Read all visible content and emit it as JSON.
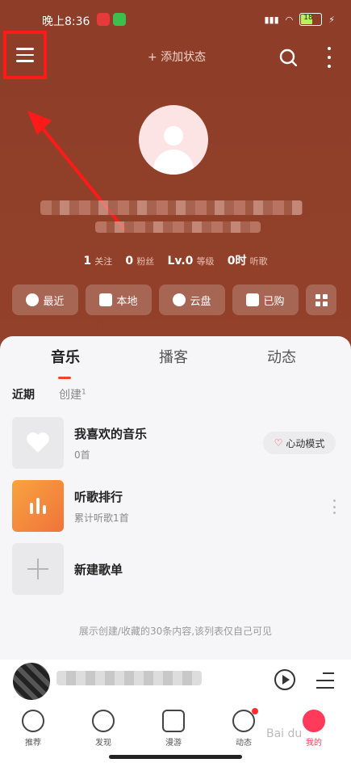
{
  "status_bar": {
    "time": "晚上8:36",
    "battery": "18"
  },
  "header": {
    "add_status": "+ 添加状态"
  },
  "profile": {
    "stats": [
      {
        "value": "1",
        "label": "关注"
      },
      {
        "value": "0",
        "label": "粉丝"
      },
      {
        "value": "Lv.0",
        "label": "等级"
      },
      {
        "value": "0时",
        "label": "听歌"
      }
    ]
  },
  "quick_actions": [
    {
      "label": "最近",
      "icon": "clock-icon"
    },
    {
      "label": "本地",
      "icon": "download-icon"
    },
    {
      "label": "云盘",
      "icon": "cloud-icon"
    },
    {
      "label": "已购",
      "icon": "bag-icon"
    },
    {
      "label": "",
      "icon": "grid-icon"
    }
  ],
  "tabs": [
    "音乐",
    "播客",
    "动态"
  ],
  "subtabs": {
    "recent": "近期",
    "created": "创建",
    "created_count": "1"
  },
  "playlists": [
    {
      "title": "我喜欢的音乐",
      "sub": "0首",
      "action": "心动模式"
    },
    {
      "title": "听歌排行",
      "sub": "累计听歌1首"
    },
    {
      "title": "新建歌单",
      "sub": ""
    }
  ],
  "footnote": "展示创建/收藏的30条内容,该列表仅自己可见",
  "tabbar": [
    {
      "label": "推荐",
      "icon": "recommend-icon"
    },
    {
      "label": "发现",
      "icon": "compass-icon"
    },
    {
      "label": "漫游",
      "icon": "radio-icon"
    },
    {
      "label": "动态",
      "icon": "chat-icon"
    },
    {
      "label": "我的",
      "icon": "user-icon"
    }
  ],
  "watermark": "Bai du"
}
